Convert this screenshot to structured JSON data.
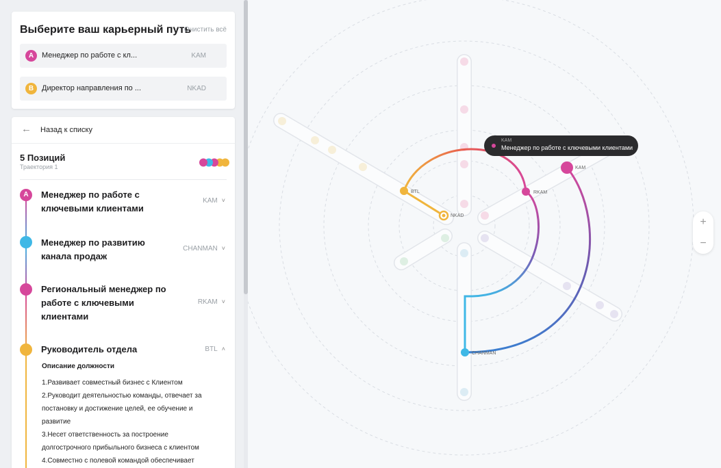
{
  "selector": {
    "title": "Выберите ваш карьерный путь",
    "clear_all": "Очистить всё",
    "a": {
      "badge": "A",
      "name": "Менеджер по работе с кл...",
      "code": "KAM"
    },
    "b": {
      "badge": "B",
      "name": "Директор направления по ...",
      "code": "NKAD"
    }
  },
  "path_panel": {
    "back": "Назад к списку",
    "positions_title": "5 Позиций",
    "trajectory": "Траектория 1",
    "items": [
      {
        "badge": "A",
        "name": "Менеджер по работе с ключевыми клиентами",
        "code": "KAM",
        "chevron": "˅"
      },
      {
        "badge": "",
        "name": "Менеджер по развитию канала продаж",
        "code": "CHANMAN",
        "chevron": "˅"
      },
      {
        "badge": "",
        "name": "Региональный менеджер по работе с ключевыми клиентами",
        "code": "RKAM",
        "chevron": "˅"
      },
      {
        "badge": "",
        "name": "Руководитель отдела",
        "code": "BTL",
        "chevron": "˄"
      }
    ],
    "description_title": "Описание должности",
    "description_lines": [
      "1.Развивает совместный бизнес с Клиентом",
      "2.Руководит деятельностью команды, отвечает за",
      "постановку и достижение целей, ее обучение и",
      "развитие",
      "3.Несет ответственность за построение",
      "долгострочного прибыльного бизнеса с клиентом",
      "4.Совместно с полевой командой обеспечивает"
    ]
  },
  "map": {
    "labels": {
      "btl": "BTL",
      "nkad": "NKAD",
      "rkam": "RKAM",
      "kam": "KAM",
      "chanman": "CHANMAN"
    },
    "tooltip": {
      "code": "KAM",
      "name": "Менеджер по работе с ключевыми клиентами"
    },
    "zoom_in": "+",
    "zoom_out": "−"
  },
  "colors": {
    "pink": "#d6479b",
    "blue": "#3fb8e6",
    "orange": "#f0b53d",
    "red": "#e85a4f",
    "purple": "#6a5ab0"
  }
}
